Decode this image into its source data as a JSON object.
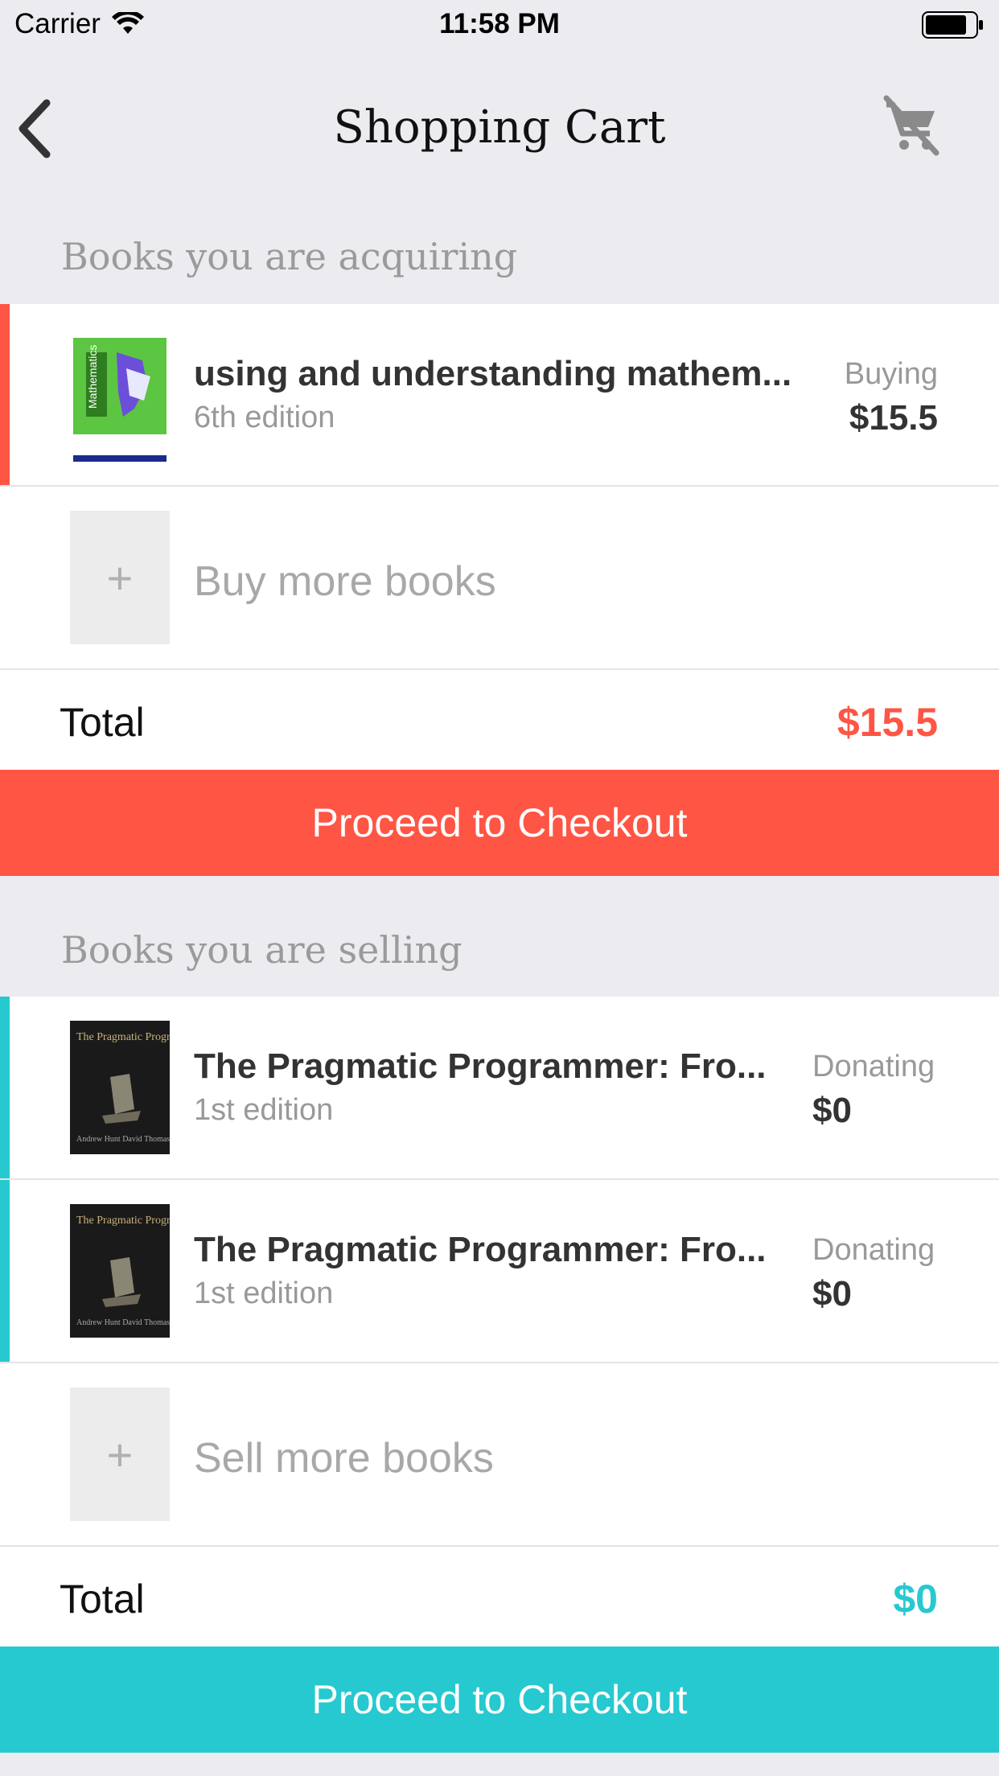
{
  "status_bar": {
    "carrier": "Carrier",
    "time": "11:58 PM"
  },
  "nav": {
    "title": "Shopping Cart",
    "back_icon": "chevron-left-icon",
    "cart_icon": "cart-off-icon"
  },
  "colors": {
    "buy_accent": "#ff5545",
    "sell_accent": "#26c9d0"
  },
  "acquiring": {
    "header": "Books you are acquiring",
    "items": [
      {
        "title": "using and understanding mathem...",
        "edition": "6th edition",
        "status": "Buying",
        "price": "$15.5",
        "cover_text": "Mathematics"
      }
    ],
    "add_label": "Buy more books",
    "add_symbol": "+",
    "total_label": "Total",
    "total_value": "$15.5",
    "checkout_label": "Proceed to Checkout"
  },
  "selling": {
    "header": "Books you are selling",
    "items": [
      {
        "title": "The Pragmatic Programmer: Fro...",
        "edition": "1st edition",
        "status": "Donating",
        "price": "$0",
        "cover_title": "The Pragmatic Programmer",
        "cover_authors": "Andrew Hunt David Thomas"
      },
      {
        "title": "The Pragmatic Programmer: Fro...",
        "edition": "1st edition",
        "status": "Donating",
        "price": "$0",
        "cover_title": "The Pragmatic Programmer",
        "cover_authors": "Andrew Hunt David Thomas"
      }
    ],
    "add_label": "Sell more books",
    "add_symbol": "+",
    "total_label": "Total",
    "total_value": "$0",
    "checkout_label": "Proceed to Checkout"
  }
}
